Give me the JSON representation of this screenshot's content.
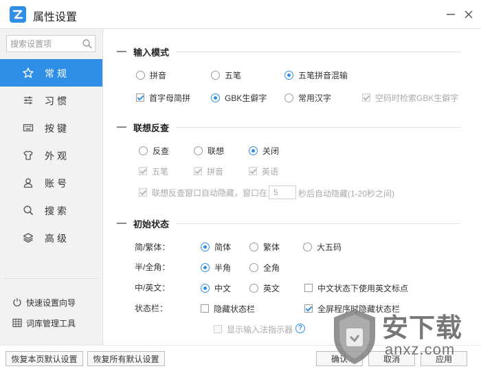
{
  "window": {
    "title": "属性设置"
  },
  "sidebar": {
    "search_placeholder": "搜索设置项",
    "items": [
      {
        "label": "常规",
        "icon": "star-icon",
        "active": true
      },
      {
        "label": "习惯",
        "icon": "sliders-icon",
        "active": false
      },
      {
        "label": "按键",
        "icon": "keyboard-icon",
        "active": false
      },
      {
        "label": "外观",
        "icon": "tshirt-icon",
        "active": false
      },
      {
        "label": "账号",
        "icon": "user-icon",
        "active": false
      },
      {
        "label": "搜索",
        "icon": "search-icon",
        "active": false
      },
      {
        "label": "高级",
        "icon": "layers-icon",
        "active": false
      }
    ],
    "links": [
      {
        "label": "快速设置向导",
        "icon": "power-icon"
      },
      {
        "label": "词库管理工具",
        "icon": "grid-icon"
      }
    ]
  },
  "input_mode": {
    "title": "输入模式",
    "modes": [
      {
        "label": "拼音",
        "checked": false
      },
      {
        "label": "五笔",
        "checked": false
      },
      {
        "label": "五笔拼音混输",
        "checked": true
      }
    ],
    "abbrev": {
      "label": "首字母简拼",
      "checked": true
    },
    "charset": [
      {
        "label": "GBK生僻字",
        "checked": true
      },
      {
        "label": "常用汉字",
        "checked": false
      }
    ],
    "empty_code_gbk": {
      "label": "空码时检索GBK生僻字",
      "checked": true,
      "disabled": true
    }
  },
  "assoc": {
    "title": "联想反查",
    "modes": [
      {
        "label": "反查",
        "checked": false
      },
      {
        "label": "联想",
        "checked": false
      },
      {
        "label": "关闭",
        "checked": true
      }
    ],
    "sub": [
      {
        "label": "五笔",
        "checked": true
      },
      {
        "label": "拼音",
        "checked": true
      },
      {
        "label": "英语",
        "checked": true
      }
    ],
    "auto_hide_label_before": "联想反查窗口自动隐藏，窗口在",
    "auto_hide_seconds": "5",
    "auto_hide_label_after": "秒后自动隐藏(1-20秒之间)"
  },
  "initial_state": {
    "title": "初始状态",
    "simp_trad": {
      "label": "简/繁体：",
      "options": [
        {
          "label": "简体",
          "checked": true
        },
        {
          "label": "繁体",
          "checked": false
        },
        {
          "label": "大五码",
          "checked": false
        }
      ]
    },
    "half_full": {
      "label": "半/全角：",
      "options": [
        {
          "label": "半角",
          "checked": true
        },
        {
          "label": "全角",
          "checked": false
        }
      ]
    },
    "cn_en": {
      "label": "中/英文：",
      "options": [
        {
          "label": "中文",
          "checked": true
        },
        {
          "label": "英文",
          "checked": false
        }
      ],
      "punct": {
        "label": "中文状态下使用英文标点",
        "checked": false
      }
    },
    "statusbar": {
      "label": "状态栏：",
      "hide": {
        "label": "隐藏状态栏",
        "checked": false
      },
      "fullscreen_hide": {
        "label": "全屏程序时隐藏状态栏",
        "checked": true
      }
    },
    "indicator": {
      "label": "显示输入法指示器",
      "checked": false,
      "disabled": true
    }
  },
  "footer": {
    "restore_page": "恢复本页默认设置",
    "restore_all": "恢复所有默认设置",
    "ok": "确认",
    "cancel": "取消",
    "apply": "应用"
  },
  "watermark": {
    "text": "安下载",
    "sub": "anxz.com"
  },
  "colors": {
    "accent": "#2f8fe6",
    "sidebar_bg": "#f2f2f2"
  }
}
